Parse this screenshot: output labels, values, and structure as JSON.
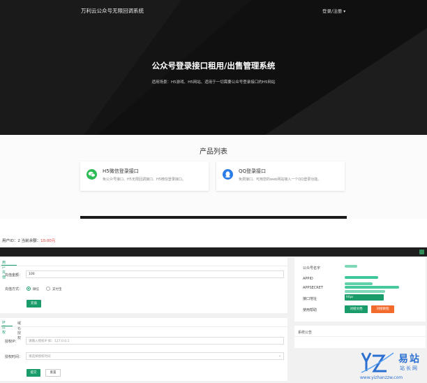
{
  "hero": {
    "brand": "万利云公众号无限回调系统",
    "login_menu": "登录/注册",
    "title_prefix": "公众号登录",
    "title_bold": "接口",
    "title_mid": "租",
    "title_bold2": "用",
    "title_suffix": "/出售管理系统",
    "subtitle": "适用场景：H5游戏、H5网站、适用于一切需要公众号登录接口的H5网站"
  },
  "products": {
    "heading": "产品列表",
    "items": [
      {
        "title": "H5微信登录接口",
        "desc": "免公众号接口、H5无限回调接口、H5微信登录接口。",
        "icon": "wechat-icon",
        "icon_color": "#2dbb55"
      },
      {
        "title": "QQ登录接口",
        "desc": "免费接口、可用您的web网站接入一个QQ登录功能。",
        "icon": "qq-icon",
        "icon_color": "#2b7de9"
      }
    ]
  },
  "admin": {
    "user_id_label": "用户ID：",
    "user_id": "2",
    "balance_label": "当前余额：",
    "balance": "10.00元",
    "recharge": {
      "tab": "用户充值",
      "amount_label": "充值金额：",
      "amount_value": "100",
      "method_label": "充值方式：",
      "method_options": [
        "微信",
        "支付宝"
      ],
      "method_selected": "微信",
      "submit": "充值"
    },
    "auth": {
      "tabs": [
        "IP授权",
        "域名授权"
      ],
      "ip_label": "授权IP：",
      "ip_placeholder": "请输入授权IP 如：127.0.0.1",
      "time_label": "授权时间：",
      "time_placeholder": "请选择授权时间",
      "submit": "提交",
      "reset": "重置"
    },
    "info": {
      "rows": [
        {
          "label": "公众号名字"
        },
        {
          "label": "APPID"
        },
        {
          "label": "APPSECRET"
        },
        {
          "label": "接口地址",
          "value_prefix": "https"
        },
        {
          "label": "使用帮助"
        }
      ],
      "doc_button": "对接文档",
      "tutorial_button": "对接教程"
    },
    "notice": {
      "title": "系统公告"
    }
  },
  "watermark": {
    "cn_big": "易站",
    "cn_small": "站长网",
    "url": "www.yizhanzzw.com"
  },
  "colors": {
    "accent_green": "#1a9c6a",
    "orange": "#f26b2c",
    "red": "#e53935",
    "hero_bg": "#141414",
    "watermark_blue": "#2b6fd0"
  }
}
